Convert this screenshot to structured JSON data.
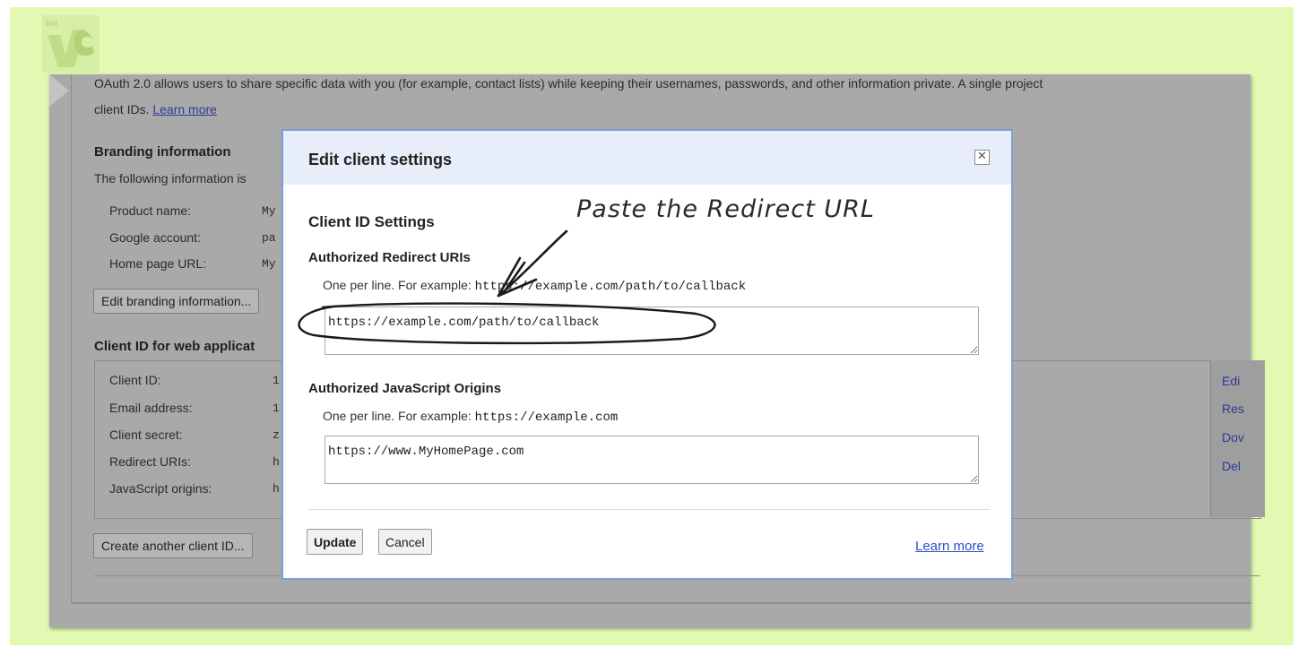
{
  "background": {
    "intro_text": "OAuth 2.0 allows users to share specific data with you (for example, contact lists) while keeping their usernames, passwords, and other information private. A single project",
    "intro_text2": "client IDs.",
    "learn_more": "Learn more",
    "branding": {
      "title": "Branding information",
      "desc": "The following information is",
      "rows": [
        {
          "label": "Product name:",
          "value": "My"
        },
        {
          "label": "Google account:",
          "value": "pa"
        },
        {
          "label": "Home page URL:",
          "value": "My"
        }
      ],
      "edit_button": "Edit branding information..."
    },
    "client": {
      "title": "Client ID for web applicat",
      "rows": [
        {
          "label": "Client ID:",
          "value": "1"
        },
        {
          "label": "Email address:",
          "value": "1"
        },
        {
          "label": "Client secret:",
          "value": "z"
        },
        {
          "label": "Redirect URIs:",
          "value": "h"
        },
        {
          "label": "JavaScript origins:",
          "value": "h"
        }
      ],
      "side_links": [
        "Edi",
        "Res",
        "Dov",
        "Del"
      ],
      "create_button": "Create another client ID..."
    }
  },
  "dialog": {
    "title": "Edit client settings",
    "close_glyph": "✕",
    "section_title": "Client ID Settings",
    "redirect": {
      "label": "Authorized Redirect URIs",
      "hint": "One per line. For example:",
      "example": "https://example.com/path/to/callback",
      "value": "https://example.com/path/to/callback"
    },
    "origins": {
      "label": "Authorized JavaScript Origins",
      "hint": "One per line. For example:",
      "example": "https://example.com",
      "value": "https://www.MyHomePage.com"
    },
    "update_button": "Update",
    "cancel_button": "Cancel",
    "learn_more": "Learn more"
  },
  "annotation": {
    "text": "Paste the Redirect URL"
  },
  "colors": {
    "frame": "#e2f8b3",
    "overlay": "#a9a9a9",
    "dialog_header": "#e7eefa",
    "dialog_border": "#7aa0d6",
    "link": "#2a4fc6"
  }
}
